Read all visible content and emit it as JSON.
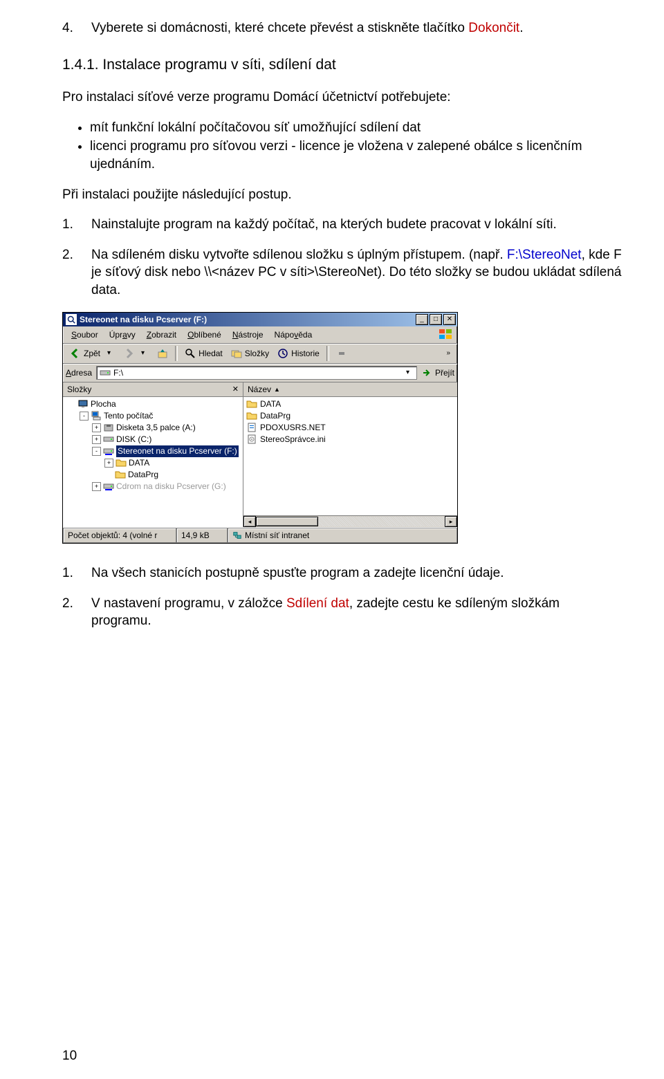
{
  "step4": {
    "num": "4.",
    "text_before": "Vyberete si domácnosti, které chcete převést a stiskněte tlačítko ",
    "text_red": "Dokončit",
    "text_after": "."
  },
  "heading": "1.4.1. Instalace programu v síti, sdílení dat",
  "intro": "Pro instalaci síťové verze programu Domácí účetnictví potřebujete:",
  "bullets": [
    "mít funkční lokální počítačovou síť umožňující sdílení dat",
    "licenci programu pro síťovou verzi - licence je vložena v zalepené obálce s licenčním ujednáním."
  ],
  "proc_intro": "Při instalaci použijte následující postup.",
  "steps": [
    {
      "num": "1.",
      "text": "Nainstalujte program na každý počítač, na kterých budete pracovat v lokální síti."
    },
    {
      "num": "2.",
      "before": "Na sdíleném disku vytvořte sdílenou složku s úplným přístupem. (např. ",
      "blue": "F:\\StereoNet",
      "mid": ", kde F je síťový disk nebo \\\\<název PC v síti>\\StereoNet). Do této složky se budou ukládat sdílená data."
    }
  ],
  "after_steps": [
    {
      "num": "1.",
      "text": "Na všech stanicích postupně spusťte program a zadejte licenční údaje."
    },
    {
      "num": "2.",
      "before": "V nastavení programu, v záložce ",
      "red": "Sdílení dat",
      "after": ", zadejte cestu ke sdíleným složkám programu."
    }
  ],
  "explorer": {
    "title": "Stereonet na disku Pcserver (F:)",
    "menu": [
      "Soubor",
      "Úpravy",
      "Zobrazit",
      "Oblíbené",
      "Nástroje",
      "Nápověda"
    ],
    "toolbar": {
      "back": "Zpět",
      "search": "Hledat",
      "folders": "Složky",
      "history": "Historie"
    },
    "address": {
      "label": "Adresa",
      "value": "F:\\",
      "go": "Přejít"
    },
    "folders_label": "Složky",
    "tree": [
      {
        "indent": 0,
        "toggle": "",
        "icon": "desktop",
        "label": "Plocha",
        "sel": false
      },
      {
        "indent": 1,
        "toggle": "-",
        "icon": "computer",
        "label": "Tento počítač",
        "sel": false
      },
      {
        "indent": 2,
        "toggle": "+",
        "icon": "floppy",
        "label": "Disketa 3,5 palce (A:)",
        "sel": false
      },
      {
        "indent": 2,
        "toggle": "+",
        "icon": "disk",
        "label": "DISK (C:)",
        "sel": false
      },
      {
        "indent": 2,
        "toggle": "-",
        "icon": "netdisk",
        "label": "Stereonet na disku Pcserver (F:)",
        "sel": true
      },
      {
        "indent": 3,
        "toggle": "+",
        "icon": "folder",
        "label": "DATA",
        "sel": false
      },
      {
        "indent": 3,
        "toggle": "",
        "icon": "folder",
        "label": "DataPrg",
        "sel": false
      },
      {
        "indent": 2,
        "toggle": "+",
        "icon": "netdisk",
        "label": "Cdrom na disku Pcserver (G:)",
        "sel": false,
        "dim": true
      }
    ],
    "list_header": "Název",
    "files": [
      {
        "icon": "folder",
        "name": "DATA"
      },
      {
        "icon": "folder",
        "name": "DataPrg"
      },
      {
        "icon": "netfile",
        "name": "PDOXUSRS.NET"
      },
      {
        "icon": "ini",
        "name": "StereoSprávce.ini"
      }
    ],
    "status": {
      "c1": "Počet objektů: 4 (volné r",
      "c2": "14,9 kB",
      "c3": "Místní síť intranet"
    }
  },
  "page_number": "10"
}
